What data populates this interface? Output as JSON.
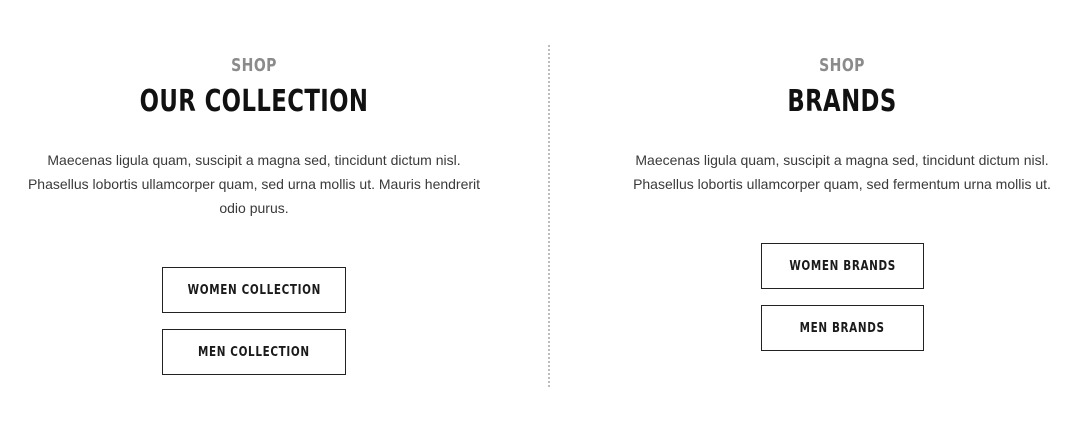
{
  "sections": [
    {
      "eyebrow": "SHOP",
      "title": "OUR COLLECTION",
      "description_line1": "Maecenas ligula quam, suscipit a magna sed, tincidunt dictum nisl.",
      "description_line2": "Phasellus lobortis ullamcorper quam, sed urna mollis ut. Mauris hendrerit",
      "description_line3": "odio purus.",
      "buttons": [
        {
          "label": "WOMEN COLLECTION"
        },
        {
          "label": "MEN COLLECTION"
        }
      ]
    },
    {
      "eyebrow": "SHOP",
      "title": "BRANDS",
      "description_line1": "Maecenas ligula quam, suscipit a magna sed, tincidunt dictum nisl.",
      "description_line2": "Phasellus lobortis ullamcorper quam, sed fermentum urna mollis ut.",
      "buttons": [
        {
          "label": "WOMEN BRANDS"
        },
        {
          "label": "MEN BRANDS"
        }
      ]
    }
  ]
}
